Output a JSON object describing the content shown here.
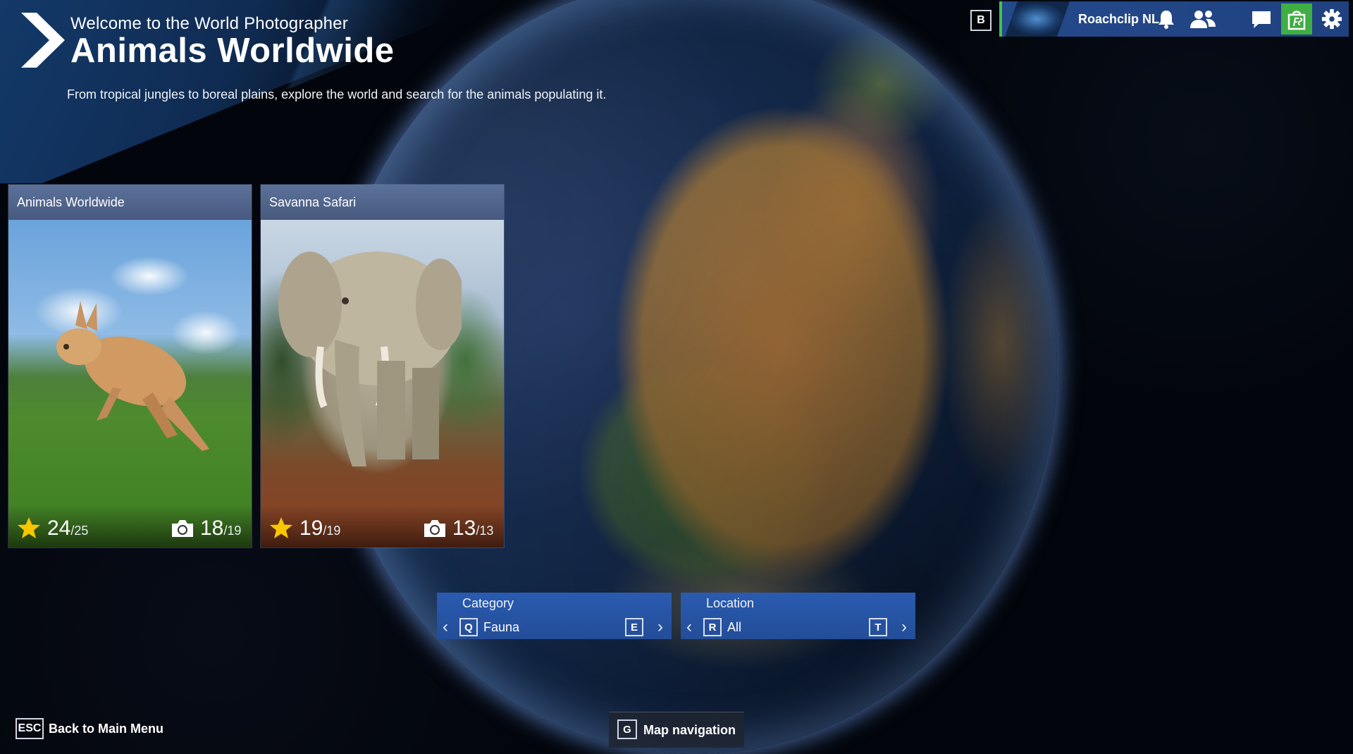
{
  "header": {
    "welcome": "Welcome to the World Photographer",
    "title": "Animals Worldwide",
    "subtitle": "From tropical jungles to boreal plains, explore the world and search for the animals populating it."
  },
  "topbar": {
    "key_hint": "B",
    "username": "Roachclip NL",
    "icons": [
      "bell-icon",
      "friends-icon",
      "chat-icon",
      "store-icon",
      "gear-icon"
    ],
    "accent": "#41c34e"
  },
  "cards": [
    {
      "title": "Animals Worldwide",
      "image": "kangaroo",
      "stars": "24",
      "stars_total": "/25",
      "photos": "18",
      "photos_total": "/19"
    },
    {
      "title": "Savanna Safari",
      "image": "elephant",
      "stars": "19",
      "stars_total": "/19",
      "photos": "13",
      "photos_total": "/13"
    }
  ],
  "filters": {
    "category": {
      "label": "Category",
      "value": "Fauna",
      "prev_key": "Q",
      "next_key": "E"
    },
    "location": {
      "label": "Location",
      "value": "All",
      "prev_key": "R",
      "next_key": "T"
    }
  },
  "footer": {
    "back_key": "ESC",
    "back_label": "Back to Main Menu",
    "map_key": "G",
    "map_label": "Map navigation"
  },
  "colors": {
    "panel_blue": "#2a5bb0",
    "star_yellow": "#f7c600"
  }
}
